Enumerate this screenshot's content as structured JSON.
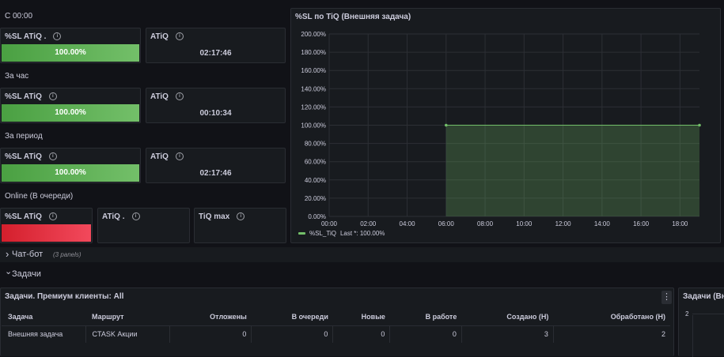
{
  "sections": {
    "today": "С 00:00",
    "hour": "За час",
    "period": "За период",
    "online": "Online (В очереди)"
  },
  "stats": {
    "today": {
      "sl_label": "%SL ATiQ .",
      "sl_value": "100.00%",
      "atiq_label": "ATiQ",
      "atiq_value": "02:17:46"
    },
    "hour": {
      "sl_label": "%SL ATiQ",
      "sl_value": "100.00%",
      "atiq_label": "ATiQ",
      "atiq_value": "00:10:34"
    },
    "period": {
      "sl_label": "%SL ATiQ",
      "sl_value": "100.00%",
      "atiq_label": "ATiQ",
      "atiq_value": "02:17:46"
    },
    "online": {
      "sl_label": "%SL ATiQ",
      "atiq_label": "ATiQ .",
      "tiq_label": "TiQ max"
    }
  },
  "info_glyph": "i",
  "colors": {
    "green": "#56a64b",
    "green_light": "#73bf69",
    "red": "#f2495c",
    "background": "#111217",
    "panel": "#181b1f"
  },
  "graph": {
    "title": "%SL по TiQ (Внешняя задача)",
    "legend_label": "%SL_TiQ",
    "legend_value": "Last *: 100.00%"
  },
  "chart_data": {
    "type": "area",
    "title": "%SL по TiQ (Внешняя задача)",
    "y_ticks": [
      "200.00%",
      "180.00%",
      "160.00%",
      "140.00%",
      "120.00%",
      "100.00%",
      "80.00%",
      "60.00%",
      "40.00%",
      "20.00%",
      "0.00%"
    ],
    "x_ticks": [
      "00:00",
      "02:00",
      "04:00",
      "06:00",
      "08:00",
      "10:00",
      "12:00",
      "14:00",
      "16:00",
      "18:00"
    ],
    "ylim": [
      0,
      200
    ],
    "xlim": [
      "00:00",
      "19:00"
    ],
    "grid": true,
    "legend_position": "bottom-left",
    "series": [
      {
        "name": "%SL_TiQ",
        "x": [
          "06:00",
          "19:00"
        ],
        "y": [
          100,
          100
        ],
        "color": "#73bf69"
      }
    ]
  },
  "rows": {
    "chatbot_title": "Чат-бот",
    "chatbot_count": "(3 panels)",
    "chatbot_chevron": "›",
    "tasks_title": "Задачи",
    "tasks_chevron": "⌄"
  },
  "table_panel": {
    "title": "Задачи. Премиум клиенты: All",
    "menu_glyph": "⋮",
    "headers": [
      "Задача",
      "Маршрут",
      "Отложены",
      "В очереди",
      "Новые",
      "В работе",
      "Создано (Н)",
      "Обработано (Н)"
    ],
    "rows": [
      [
        "Внешняя задача",
        "CTASK Акции",
        "0",
        "0",
        "0",
        "0",
        "3",
        "2"
      ]
    ]
  },
  "side_panel": {
    "title": "Задачи (Вн",
    "y_value": "2"
  }
}
